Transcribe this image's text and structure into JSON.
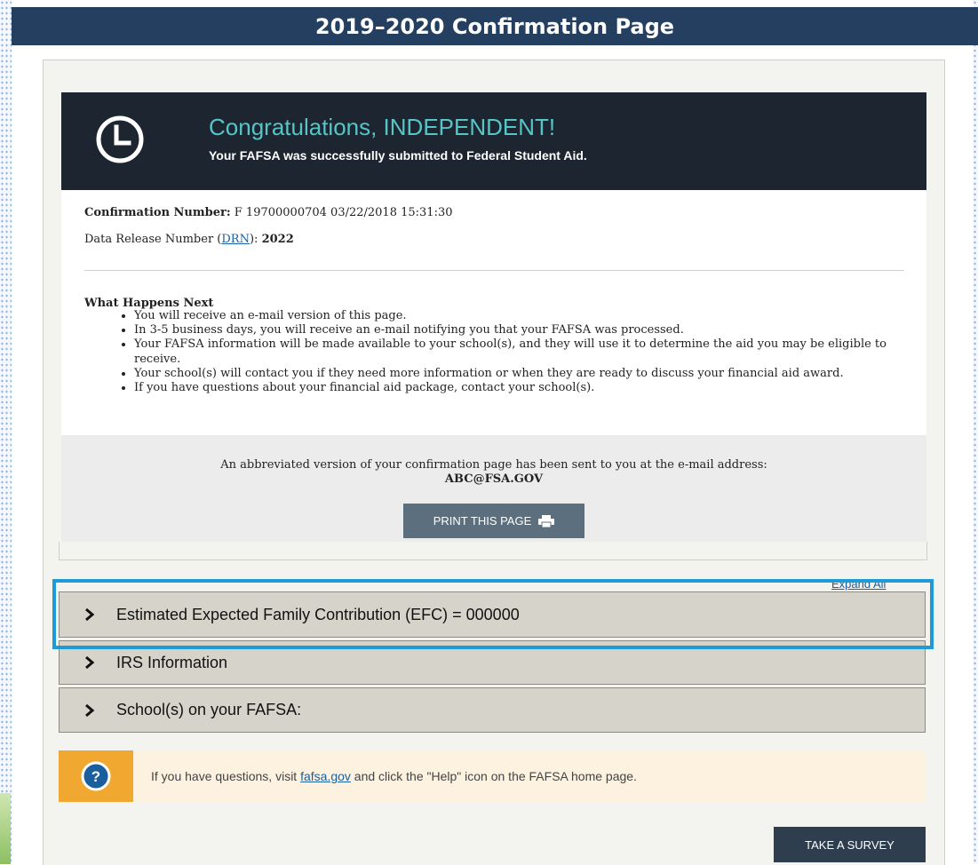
{
  "slide": {
    "title": "2019–2020 Confirmation Page"
  },
  "congrats": {
    "title": "Congratulations, INDEPENDENT!",
    "subtitle": "Your FAFSA was successfully submitted to Federal Student Aid.",
    "icon": "clock-icon",
    "colors": {
      "bar": "#1c2530",
      "title": "#56c5c8"
    }
  },
  "confirmation": {
    "number_label": "Confirmation Number:",
    "number_value": "F 19700000704 03/22/2018 15:31:30",
    "drn_label_prefix": "Data Release Number (",
    "drn_link": "DRN",
    "drn_label_suffix": "):",
    "drn_value": "2022"
  },
  "next_steps": {
    "heading": "What Happens Next",
    "items": [
      "You will receive an e-mail version of this page.",
      "In 3-5 business days, you will receive an e-mail notifying you that your FAFSA was processed.",
      "Your FAFSA information will be made available to your school(s), and they will use it to determine the aid you may be eligible to receive.",
      "Your school(s) will contact you if they need more information or when they are ready to discuss your financial aid award.",
      "If you have questions about your financial aid package, contact your school(s)."
    ]
  },
  "email_notice": {
    "text": "An abbreviated version of your confirmation page has been sent to you at the e-mail address:",
    "address": "ABC@FSA.GOV"
  },
  "print_button": {
    "label": "PRINT THIS PAGE",
    "icon": "printer-icon"
  },
  "expand_all": "Expand All",
  "accordions": [
    {
      "label": "Estimated Expected Family Contribution (EFC) = 000000",
      "highlighted": true
    },
    {
      "label": "IRS Information"
    },
    {
      "label": "School(s) on your FAFSA:"
    }
  ],
  "help": {
    "icon": "question-icon",
    "text_before": "If you have questions, visit ",
    "link": "fafsa.gov",
    "text_after": " and click the \"Help\" icon on the FAFSA home page."
  },
  "survey_button": {
    "label": "TAKE A SURVEY"
  },
  "colors": {
    "highlight": "#1e9ad6",
    "header": "#243f60",
    "help_accent": "#f0a830"
  }
}
